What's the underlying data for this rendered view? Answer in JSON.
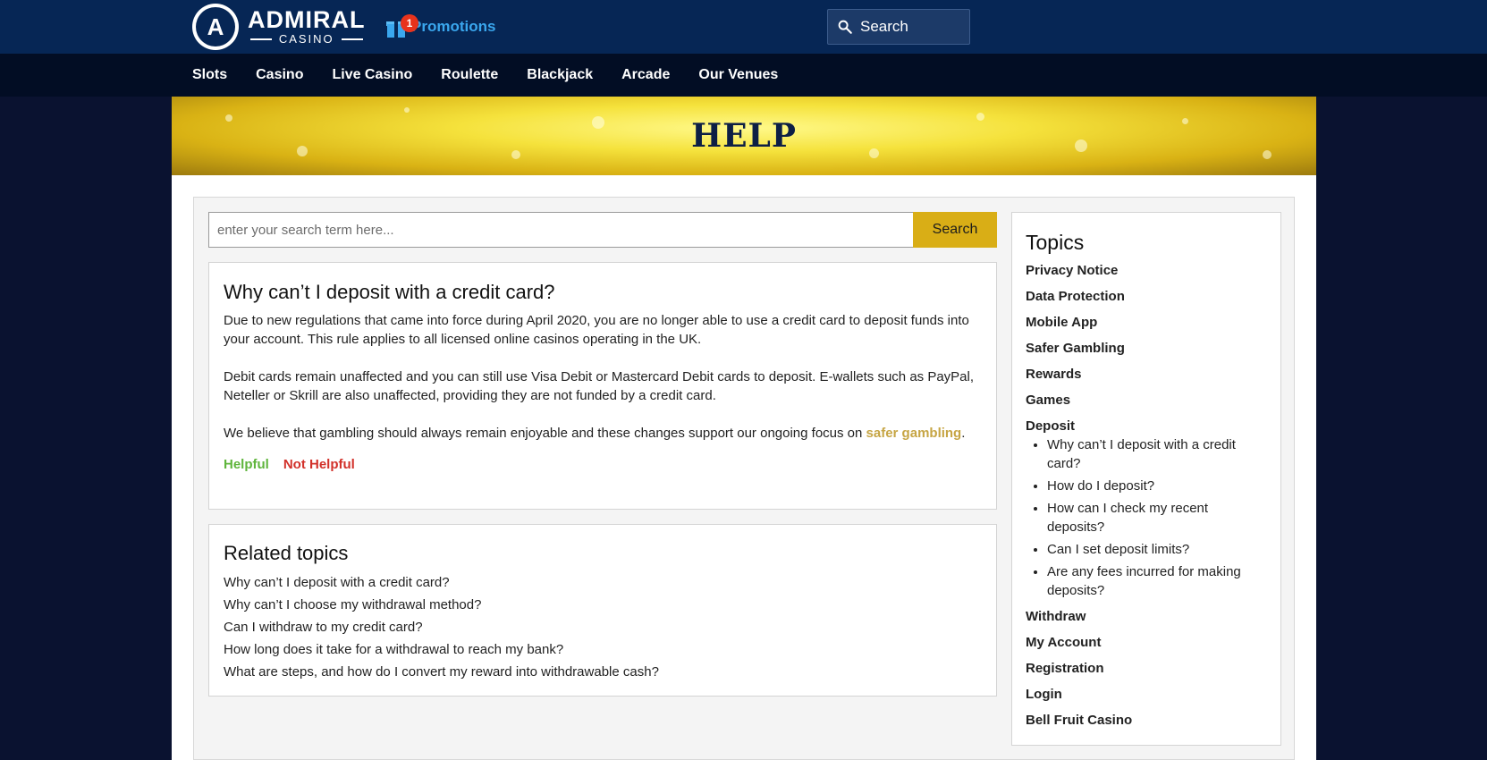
{
  "header": {
    "logo": {
      "brand": "ADMIRAL",
      "sub": "CASINO",
      "mark": "A"
    },
    "promotions": {
      "label": "Promotions",
      "badge": "1"
    },
    "search": {
      "label": "Search"
    }
  },
  "nav": [
    "Slots",
    "Casino",
    "Live Casino",
    "Roulette",
    "Blackjack",
    "Arcade",
    "Our Venues"
  ],
  "banner": {
    "title": "HELP"
  },
  "help_search": {
    "placeholder": "enter your search term here...",
    "button": "Search"
  },
  "article": {
    "title": "Why can’t I deposit with a credit card?",
    "p1": "Due to new regulations that came into force during April 2020, you are no longer able to use a credit card to deposit funds into your account. This rule applies to all licensed online casinos operating in the UK.",
    "p2": "Debit cards remain unaffected and you can still use Visa Debit or Mastercard Debit cards to deposit. E-wallets such as PayPal, Neteller or Skrill are also unaffected, providing they are not funded by a credit card.",
    "p3_before": "We believe that gambling should always remain enjoyable and these changes support our ongoing focus on ",
    "p3_link": "safer gambling",
    "p3_after": ".",
    "helpful": "Helpful",
    "not_helpful": "Not Helpful"
  },
  "related": {
    "title": "Related topics",
    "items": [
      "Why can’t I deposit with a credit card?",
      "Why can’t I choose my withdrawal method?",
      "Can I withdraw to my credit card?",
      "How long does it take for a withdrawal to reach my bank?",
      "What are steps, and how do I convert my reward into withdrawable cash?"
    ]
  },
  "topics": {
    "title": "Topics",
    "items": [
      "Privacy Notice",
      "Data Protection",
      "Mobile App",
      "Safer Gambling",
      "Rewards",
      "Games",
      "Deposit",
      "Withdraw",
      "My Account",
      "Registration",
      "Login",
      "Bell Fruit Casino"
    ],
    "deposit_sub": [
      "Why can’t I deposit with a credit card?",
      "How do I deposit?",
      "How can I check my recent deposits?",
      "Can I set deposit limits?",
      "Are any fees incurred for making deposits?"
    ]
  },
  "colors": {
    "header": "#062655",
    "nav": "#020d24",
    "gold": "#d9ae16",
    "promo": "#3aa7ee",
    "helpful": "#5fb53c",
    "not_helpful": "#d2312a"
  }
}
